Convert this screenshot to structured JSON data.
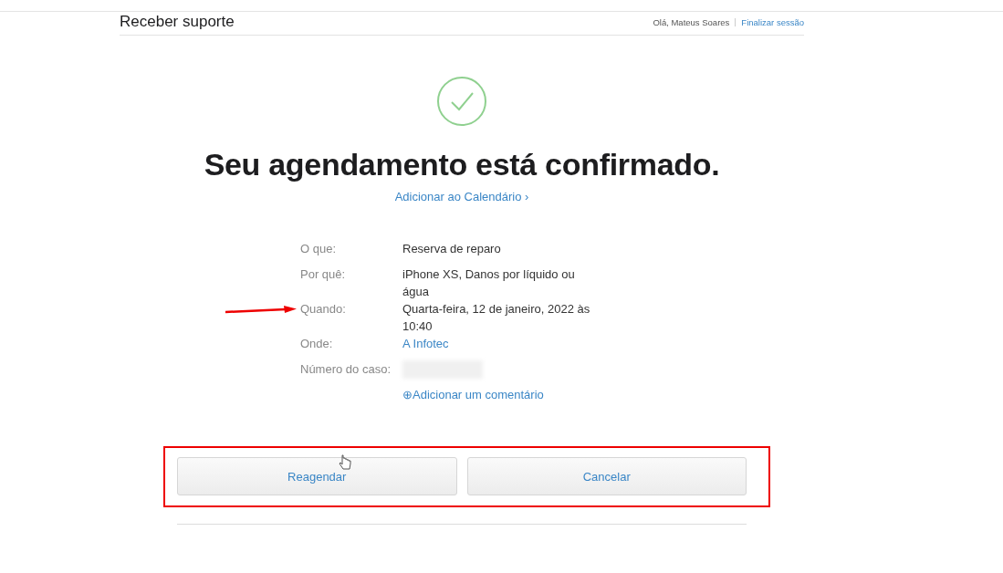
{
  "header": {
    "title": "Receber suporte",
    "greeting": "Olá, Mateus Soares",
    "signout": "Finalizar sessão"
  },
  "confirmation": {
    "heading": "Seu agendamento está confirmado.",
    "calendar_link": "Adicionar ao Calendário ›"
  },
  "details": [
    {
      "label": "O que:",
      "kind": "text",
      "value": "Reserva de reparo"
    },
    {
      "label": "Por quê:",
      "kind": "text",
      "value": "iPhone XS, Danos por líquido ou água"
    },
    {
      "label": "Quando:",
      "kind": "text",
      "value": "Quarta-feira, 12 de janeiro, 2022 às 10:40"
    },
    {
      "label": "Onde:",
      "kind": "link",
      "value": "A Infotec"
    },
    {
      "label": "Número do caso:",
      "kind": "redacted"
    }
  ],
  "comment_link": {
    "icon": "⊕",
    "label": "Adicionar um comentário"
  },
  "buttons": [
    "Reagendar",
    "Cancelar"
  ]
}
